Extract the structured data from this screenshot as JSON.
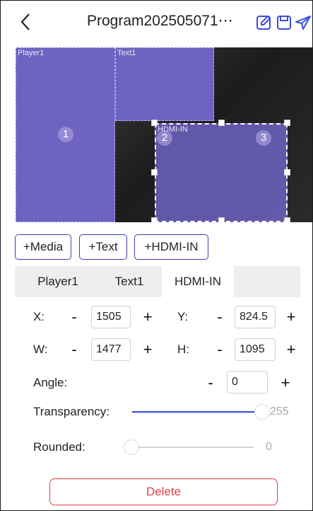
{
  "header": {
    "title": "Program202505071⋯",
    "icons": [
      "back-icon",
      "edit-icon",
      "save-icon",
      "send-icon"
    ]
  },
  "canvas": {
    "windows": [
      {
        "label": "Player1",
        "number": "1"
      },
      {
        "label": "Text1",
        "number": ""
      },
      {
        "label": "HDMI-IN",
        "number": "2"
      },
      {
        "label": "",
        "number": "3"
      }
    ]
  },
  "add_buttons": {
    "media": "+Media",
    "text": "+Text",
    "hdmi": "+HDMI-IN"
  },
  "tabs": [
    "Player1",
    "Text1",
    "HDMI-IN"
  ],
  "active_tab": "HDMI-IN",
  "properties": {
    "x": {
      "label": "X:",
      "value": "1505"
    },
    "y": {
      "label": "Y:",
      "value": "824.5"
    },
    "w": {
      "label": "W:",
      "value": "1477"
    },
    "h": {
      "label": "H:",
      "value": "1095"
    },
    "angle": {
      "label": "Angle:",
      "value": "0"
    },
    "transparency": {
      "label": "Transparency:",
      "value": "255",
      "max": 255
    },
    "rounded": {
      "label": "Rounded:",
      "value": "0",
      "max": 255
    }
  },
  "stepper": {
    "minus": "-",
    "plus": "+"
  },
  "delete_label": "Delete",
  "colors": {
    "accent": "#3a3fb0",
    "window_fill": "#6f63c2",
    "slider_active": "#2d45d8",
    "delete": "#e04040"
  }
}
